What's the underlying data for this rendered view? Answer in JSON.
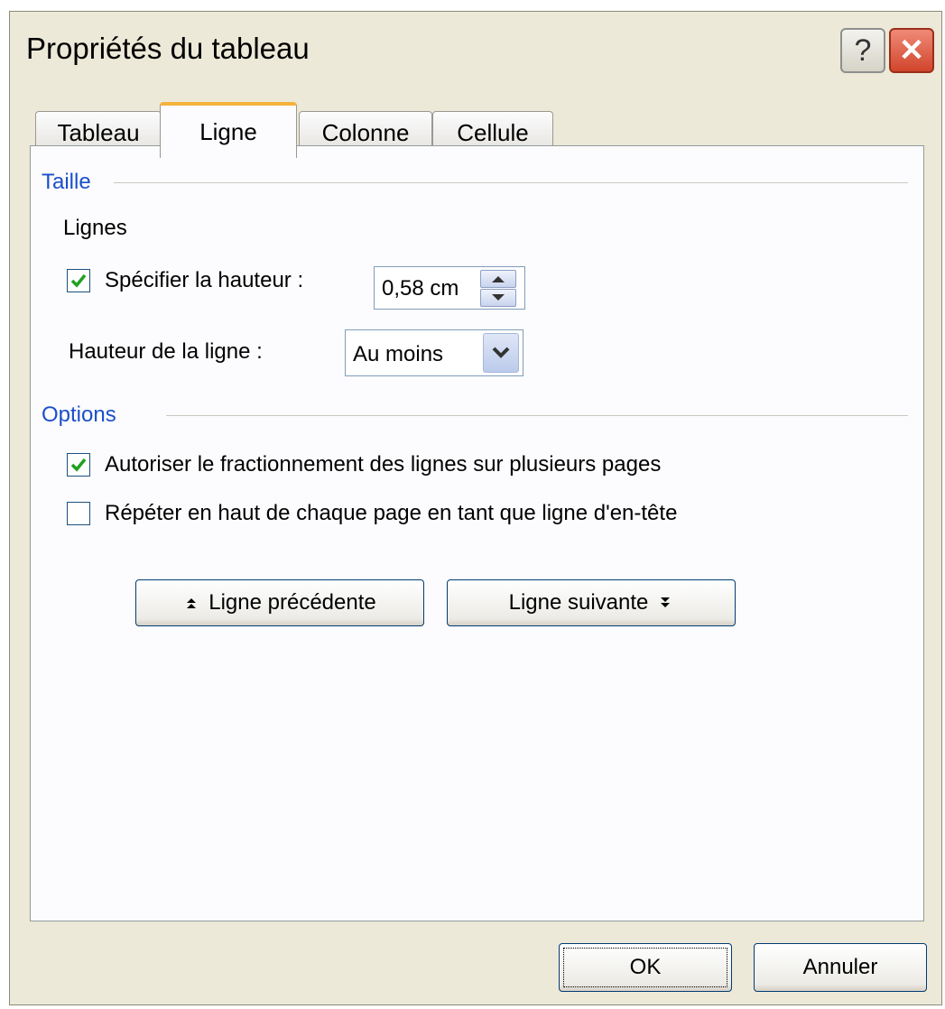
{
  "window": {
    "title": "Propriétés du tableau",
    "help_glyph": "?",
    "close_glyph": "✕"
  },
  "tabs": [
    {
      "label": "Tableau",
      "active": false
    },
    {
      "label": "Ligne",
      "active": true
    },
    {
      "label": "Colonne",
      "active": false
    },
    {
      "label": "Cellule",
      "active": false
    }
  ],
  "taille": {
    "group_label": "Taille",
    "section_label": "Lignes",
    "specify_height": {
      "label": "Spécifier la hauteur :",
      "checked": true
    },
    "height_value": "0,58 cm",
    "row_height_label": "Hauteur de la ligne :",
    "row_height_value": "Au moins"
  },
  "options": {
    "group_label": "Options",
    "allow_break": {
      "label": "Autoriser le fractionnement des lignes sur plusieurs pages",
      "checked": true
    },
    "repeat_header": {
      "label": "Répéter en haut de chaque page en tant que ligne d'en-tête",
      "checked": false
    }
  },
  "nav": {
    "previous_label": "Ligne précédente",
    "next_label": "Ligne suivante"
  },
  "footer": {
    "ok_label": "OK",
    "cancel_label": "Annuler"
  },
  "colors": {
    "dialog_bg": "#ece9d8",
    "group_label": "#1b4fc9",
    "active_tab_accent": "#f5b33d",
    "checkmark": "#21a121"
  },
  "icons": {
    "help": "help-icon",
    "close": "close-icon",
    "check": "checkmark-icon",
    "spin_up": "spin-up-icon",
    "spin_down": "spin-down-icon",
    "dropdown": "chevron-down-icon",
    "prev": "arrow-up-icon",
    "next": "arrow-down-icon"
  }
}
